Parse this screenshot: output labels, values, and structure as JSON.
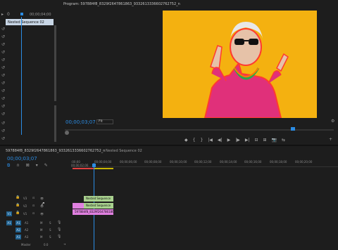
{
  "source": {
    "timecode": "00;00;04;00",
    "sequence_item": "Nested Sequence 02"
  },
  "program": {
    "title": "Program: 597884f8_8329f2647861863_9332613336602762752_n",
    "timecode": "00;00;03;07",
    "fit": "Fit",
    "controls": [
      "◆",
      "{",
      "}",
      "|◀",
      "◀|",
      "▶",
      "|▶",
      "▶|",
      "⊟",
      "⊞",
      "📷",
      "⇆"
    ]
  },
  "timeline": {
    "tab_main": "597884f8_8329f2647861863_9332613336602762752_n",
    "tab_nested": "Nested Sequence 02",
    "timecode": "00;00;03;07",
    "ticks": [
      ":00;00",
      "00;00;02;00",
      "00;00;04;00",
      "00;00;06;00",
      "00;00;08;00",
      "00;00;10;00",
      "00;00;12;00",
      "00;00;14;00",
      "00;00;16;00",
      "00;00;18;00",
      "00;00;20;00"
    ],
    "tracks": {
      "v3": "V3",
      "v2": "V2",
      "v1": "V1",
      "a1": "A1",
      "a2": "A2",
      "a3": "A3",
      "master": "Master",
      "master_value": "0.0"
    },
    "clips": {
      "clip1": "Nested Sequence",
      "clip2": "Nested Sequence",
      "clip4": "597884f8_8329f2647861863"
    }
  }
}
